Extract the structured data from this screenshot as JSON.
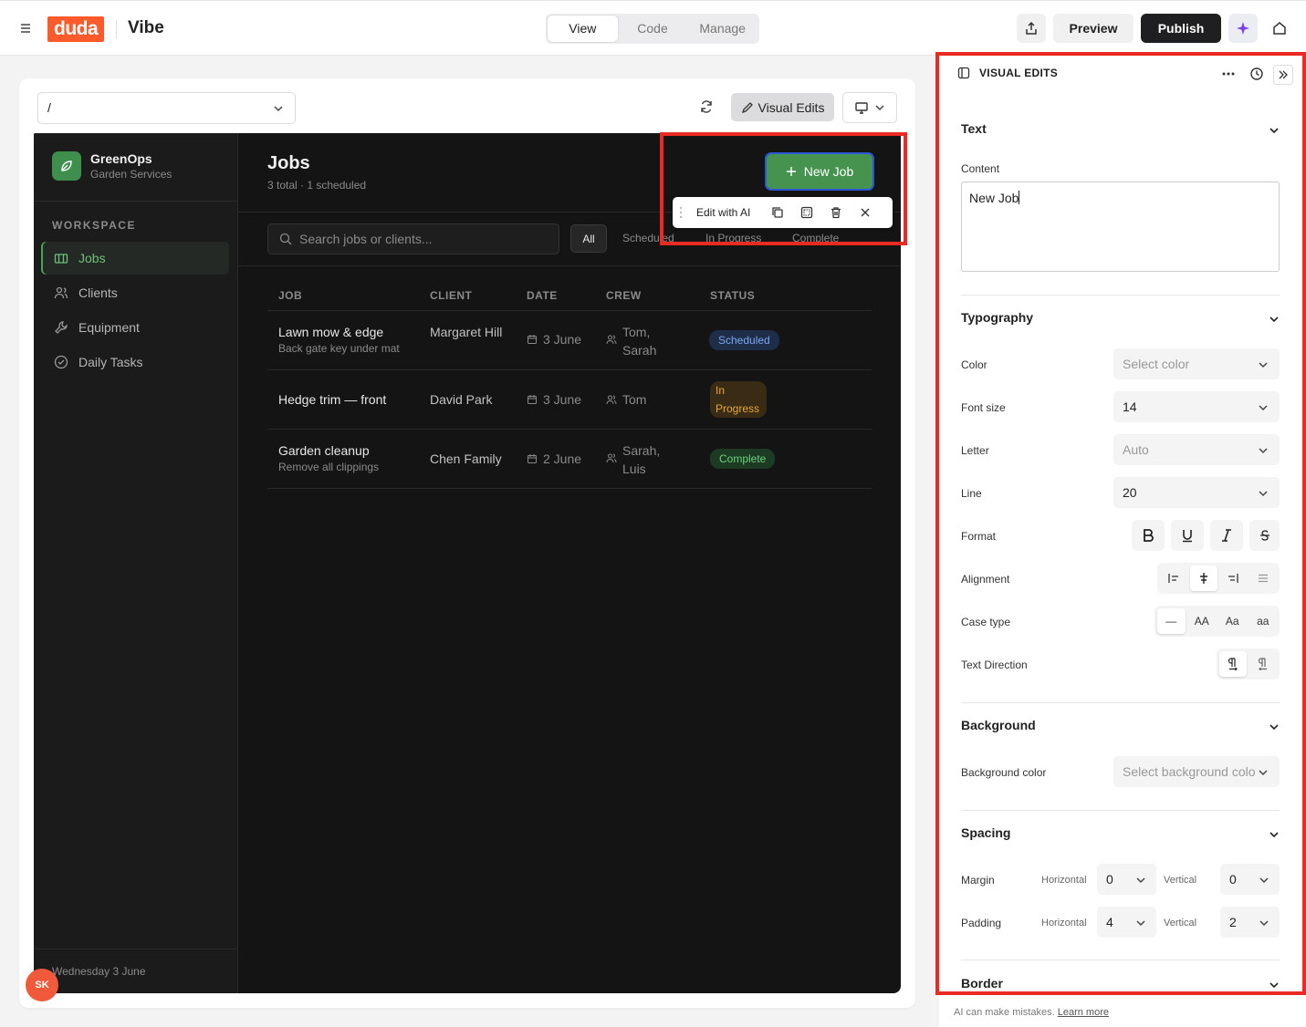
{
  "topbar": {
    "logo": "duda",
    "app_name": "Vibe",
    "modes": [
      "View",
      "Code",
      "Manage"
    ],
    "active_mode": "View",
    "preview": "Preview",
    "publish": "Publish"
  },
  "canvas": {
    "route": "/",
    "visual_edits": "Visual Edits"
  },
  "site": {
    "brand_name": "GreenOps",
    "brand_sub": "Garden Services",
    "workspace_label": "WORKSPACE",
    "nav": [
      "Jobs",
      "Clients",
      "Equipment",
      "Daily Tasks"
    ],
    "active_nav": "Jobs",
    "footer_date": "Wednesday 3 June",
    "user_initials": "SK",
    "page_title": "Jobs",
    "page_subtitle": "3 total · 1 scheduled",
    "new_job": "New Job",
    "search_placeholder": "Search jobs or clients...",
    "filters": [
      "All",
      "Scheduled",
      "In Progress",
      "Complete"
    ],
    "columns": [
      "JOB",
      "CLIENT",
      "DATE",
      "CREW",
      "STATUS"
    ],
    "rows": [
      {
        "job": "Lawn mow & edge",
        "note": "Back gate key under mat",
        "client": "Margaret Hill",
        "date": "3 June",
        "crew": "Tom, Sarah",
        "status": "Scheduled"
      },
      {
        "job": "Hedge trim — front",
        "note": "",
        "client": "David Park",
        "date": "3 June",
        "crew": "Tom",
        "status": "In Progress"
      },
      {
        "job": "Garden cleanup",
        "note": "Remove all clippings",
        "client": "Chen Family",
        "date": "2 June",
        "crew": "Sarah, Luis",
        "status": "Complete"
      }
    ]
  },
  "element_toolbar": {
    "edit_ai": "Edit with AI"
  },
  "panel": {
    "title": "VISUAL EDITS",
    "text_section": "Text",
    "content_label": "Content",
    "content_value": "New Job",
    "typography_section": "Typography",
    "color_label": "Color",
    "color_value": "Select color",
    "font_size_label": "Font size",
    "font_size_value": "14",
    "letter_label": "Letter",
    "letter_value": "Auto",
    "line_label": "Line",
    "line_value": "20",
    "format_label": "Format",
    "alignment_label": "Alignment",
    "case_label": "Case type",
    "case_options": [
      "—",
      "AA",
      "Aa",
      "aa"
    ],
    "direction_label": "Text Direction",
    "background_section": "Background",
    "bg_color_label": "Background color",
    "bg_color_value": "Select background colo",
    "spacing_section": "Spacing",
    "margin_label": "Margin",
    "padding_label": "Padding",
    "horizontal_label": "Horizontal",
    "vertical_label": "Vertical",
    "margin_h": "0",
    "margin_v": "0",
    "padding_h": "4",
    "padding_v": "2",
    "border_section": "Border"
  },
  "disclaimer": {
    "text": "AI can make mistakes.",
    "link": "Learn more"
  },
  "colors": {
    "brand": "#ff5a2c",
    "green": "#45934f",
    "highlight": "#ec2a24",
    "app_bg": "#141414"
  }
}
